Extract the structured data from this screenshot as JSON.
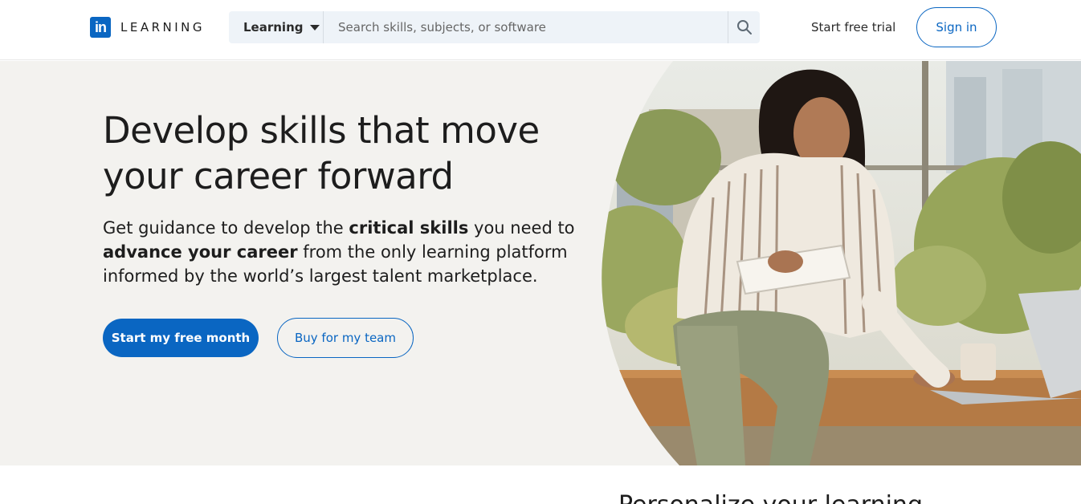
{
  "header": {
    "logo_badge": "in",
    "logo_text": "LEARNING",
    "search": {
      "category": "Learning",
      "placeholder": "Search skills, subjects, or software"
    },
    "trial_link": "Start free trial",
    "signin": "Sign in"
  },
  "hero": {
    "title_line1": "Develop skills that move",
    "title_line2": "your career forward",
    "subtitle": {
      "part1": "Get guidance to develop the ",
      "bold1": "critical skills",
      "part2": " you need to ",
      "bold2": "advance your career",
      "part3": " from the only learning platform informed by the world’s largest talent marketplace."
    },
    "primary_cta": "Start my free month",
    "secondary_cta": "Buy for my team",
    "image_alt": "woman-writing-in-notebook-photo"
  },
  "next_section": {
    "heading_partial": "Personalize your learning"
  },
  "colors": {
    "brand": "#0a66c2",
    "hero_bg": "#f3f2ef",
    "text": "#1d1d1d"
  }
}
